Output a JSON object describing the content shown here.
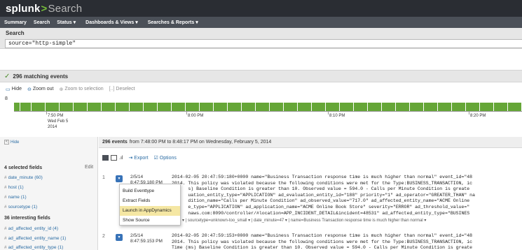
{
  "app": {
    "brand": "splunk",
    "separator": ">",
    "app_name": "Search"
  },
  "menubar": {
    "items": [
      "Summary",
      "Search",
      "Status",
      "Dashboards & Views",
      "Searches & Reports"
    ],
    "caret": "▾"
  },
  "search": {
    "label": "Search",
    "query": "source=\"http-simple\""
  },
  "matching": {
    "text": "296 matching events"
  },
  "timeline_controls": {
    "hide": "Hide",
    "zoom_out": "Zoom out",
    "zoom_to_selection": "Zoom to selection",
    "deselect": "Deselect"
  },
  "timeline": {
    "y_max": "8",
    "bar_color": "#65a637",
    "labels": {
      "first": [
        "7:50 PM",
        "Wed Feb 5",
        "2014"
      ],
      "second": "8:00 PM",
      "third": "8:10 PM",
      "fourth": "8:20 PM"
    }
  },
  "sidebar": {
    "hide": "Hide",
    "selected_header": "4 selected fields",
    "edit": "Edit",
    "selected_fields": [
      "date_minute (60)",
      "host (1)",
      "name (1)",
      "sourcetype (1)"
    ],
    "interesting_header": "36 interesting fields",
    "interesting_fields": [
      "ad_affected_entity_id (4)",
      "ad_affected_entity_name (1)",
      "ad_affected_entity_type (1)"
    ]
  },
  "results": {
    "count": "296 events",
    "range": "from 7:48:00 PM to 8:48:17 PM on Wednesday, February 5, 2014",
    "export": "Export",
    "options": "Options"
  },
  "events": [
    {
      "num": "1",
      "date": "2/5/14",
      "time": "8:47:59.180 PM",
      "raw": "2014-02-05 20:47:59:180+0000 name=\"Business Transaction response time is much higher than normal\" event_id=\"48\n2014. This policy was violated because the following conditions were met for the Type:BUSINESS_TRANSACTION, ic\n      s) Baseline Condition is greater than 10. Observed value = 594.0 - Calls per Minute Condition is greate\n      uation_entity_type=\"APPLICATION\" ad_evaluation_entity_id=\"188\" priority=\"1\" ad_operator=\"GREATER_THAN\" na\n      dition_name=\"Calls per Minute Condition\" ad_observed_value=\"717.0\" ad_affected_entity_name=\"ACME Online\n      e_type=\"APPLICATION\" ad_application_name=\"ACME Online Book Store\" severity=\"ERROR\" ad_threshold_value=\"\n      naws.com:8090/controller/#location=APP_INCIDENT_DETAIL&incident=48531\" ad_affected_entity_type=\"BUSINES",
      "meta": "0.0.1 ▾ | sourcetype=unknown-too_small ▾ | date_minute=47 ▾ | name=Business Transaction response time is much higher than normal ▾"
    },
    {
      "num": "2",
      "date": "2/5/14",
      "time": "8:47:59.153 PM",
      "raw": "2014-02-05 20:47:59:153+0000 name=\"Business Transaction response time is much higher than normal\" event_id=\"48\n2014. This policy was violated because the following conditions were met for the Type:BUSINESS_TRANSACTION, ic\nTime (ms) Baseline Condition is greater than 10. Observed value = 594.0 - Calls per Minute Condition is greate"
    }
  ],
  "context_menu": {
    "items": [
      "Build Eventtype",
      "Extract Fields",
      "Launch in AppDynamics",
      "Show Source"
    ],
    "highlighted": "Launch in AppDynamics",
    "highlight_color": "#f5e7a3"
  }
}
